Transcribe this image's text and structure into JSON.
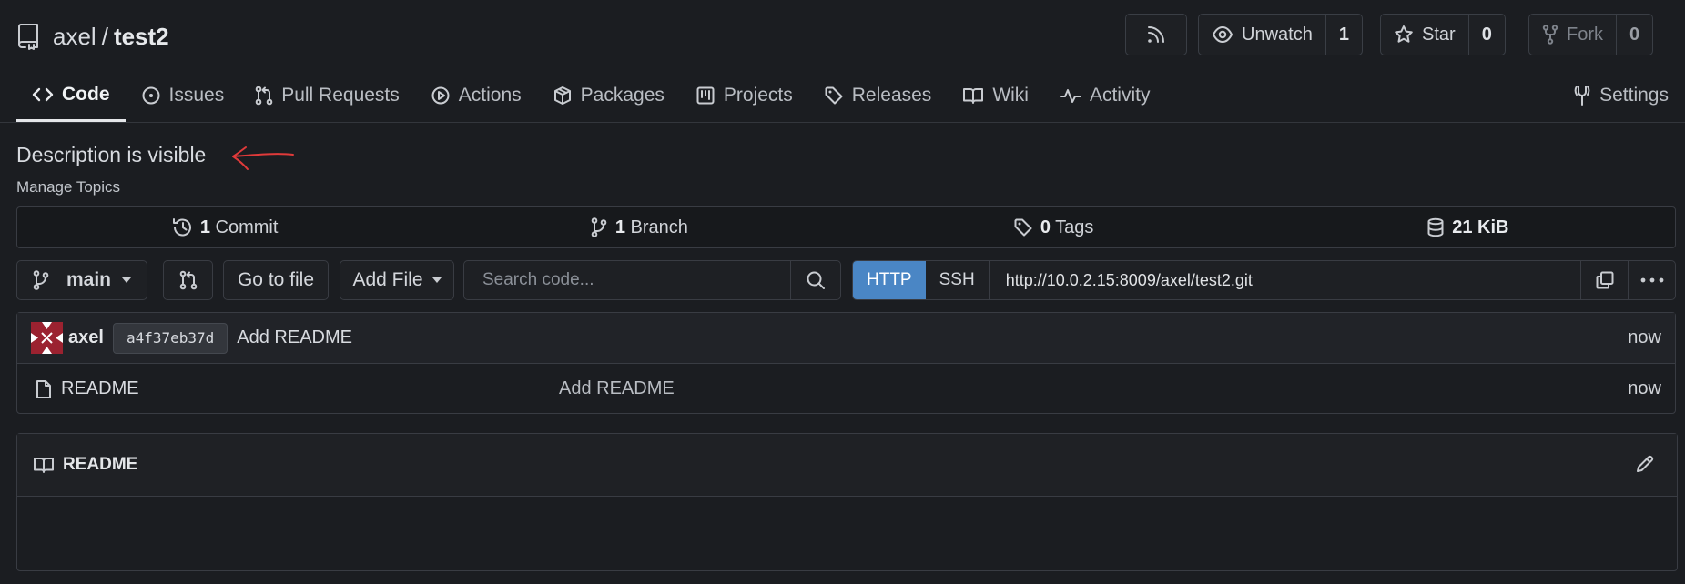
{
  "repo": {
    "owner": "axel",
    "separator": "/",
    "name": "test2"
  },
  "header_buttons": {
    "unwatch": {
      "label": "Unwatch",
      "count": "1"
    },
    "star": {
      "label": "Star",
      "count": "0"
    },
    "fork": {
      "label": "Fork",
      "count": "0"
    }
  },
  "tabs": [
    {
      "label": "Code",
      "icon": "code-icon",
      "active": true
    },
    {
      "label": "Issues",
      "icon": "issue-icon"
    },
    {
      "label": "Pull Requests",
      "icon": "pull-request-icon"
    },
    {
      "label": "Actions",
      "icon": "play-icon"
    },
    {
      "label": "Packages",
      "icon": "package-icon"
    },
    {
      "label": "Projects",
      "icon": "project-icon"
    },
    {
      "label": "Releases",
      "icon": "tag-icon"
    },
    {
      "label": "Wiki",
      "icon": "book-icon"
    },
    {
      "label": "Activity",
      "icon": "pulse-icon"
    }
  ],
  "settings_label": "Settings",
  "description": "Description is visible",
  "manage_topics": "Manage Topics",
  "stats": {
    "commits": {
      "count": "1",
      "label": "Commit"
    },
    "branches": {
      "count": "1",
      "label": "Branch"
    },
    "tags": {
      "count": "0",
      "label": "Tags"
    },
    "size": {
      "value": "21 KiB"
    }
  },
  "toolbar": {
    "branch": "main",
    "go_to_file": "Go to file",
    "add_file": "Add File",
    "search_placeholder": "Search code...",
    "clone_http": "HTTP",
    "clone_ssh": "SSH",
    "clone_url": "http://10.0.2.15:8009/axel/test2.git"
  },
  "latest_commit": {
    "author": "axel",
    "sha": "a4f37eb37d",
    "message": "Add README",
    "time": "now"
  },
  "files": [
    {
      "name": "README",
      "message": "Add README",
      "time": "now"
    }
  ],
  "readme": {
    "title": "README"
  },
  "colors": {
    "background": "#1b1d21",
    "http_active": "#4a86c5",
    "annotation_arrow": "#e03a3a"
  }
}
